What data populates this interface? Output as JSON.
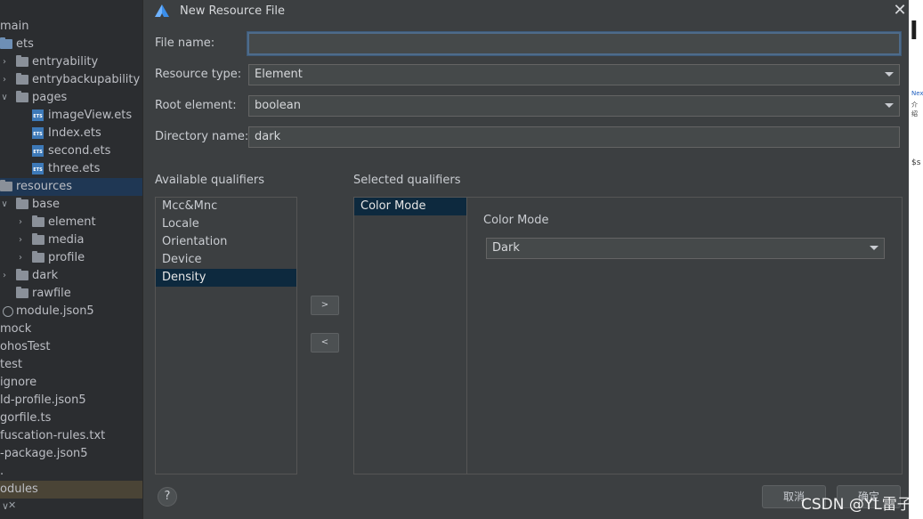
{
  "tree": {
    "items": [
      {
        "label": "main"
      },
      {
        "label": "ets"
      },
      {
        "label": "entryability"
      },
      {
        "label": "entrybackupability"
      },
      {
        "label": "pages"
      },
      {
        "label": "imageView.ets"
      },
      {
        "label": "Index.ets"
      },
      {
        "label": "second.ets"
      },
      {
        "label": "three.ets"
      },
      {
        "label": "resources"
      },
      {
        "label": "base"
      },
      {
        "label": "element"
      },
      {
        "label": "media"
      },
      {
        "label": "profile"
      },
      {
        "label": "dark"
      },
      {
        "label": "rawfile"
      },
      {
        "label": "module.json5"
      },
      {
        "label": "mock"
      },
      {
        "label": "ohosTest"
      },
      {
        "label": "test"
      },
      {
        "label": "ignore"
      },
      {
        "label": "ld-profile.json5"
      },
      {
        "label": "gorfile.ts"
      },
      {
        "label": "fuscation-rules.txt"
      },
      {
        "label": "-package.json5"
      },
      {
        "label": "."
      },
      {
        "label": "odules"
      }
    ],
    "ets_badge": "ETS"
  },
  "dialog": {
    "title": "New Resource File",
    "close_icon": "close-icon",
    "file_name_label": "File name:",
    "file_name_value": "",
    "resource_type_label": "Resource type:",
    "resource_type_value": "Element",
    "root_element_label": "Root element:",
    "root_element_value": "boolean",
    "directory_name_label": "Directory name:",
    "directory_name_value": "dark",
    "available_label": "Available qualifiers",
    "selected_label": "Selected qualifiers",
    "available_qualifiers": [
      "Mcc&Mnc",
      "Locale",
      "Orientation",
      "Device",
      "Density"
    ],
    "available_selected": "Density",
    "selected_qualifiers": [
      "Color Mode"
    ],
    "add_button": ">",
    "remove_button": "<",
    "detail_title": "Color Mode",
    "detail_value": "Dark",
    "help_button": "?",
    "cancel_button": "取消",
    "ok_button": "确定"
  },
  "editor": {
    "big_text": "l",
    "tiny_1": "Nex",
    "tiny_2": "介绍",
    "tiny_3": "$s"
  },
  "watermark": "CSDN @YL雷子",
  "colors": {
    "dialog_bg": "#3c3f41",
    "tree_bg": "#2b2d30",
    "selection": "#0d293e",
    "tree_selection": "#1f3754"
  }
}
